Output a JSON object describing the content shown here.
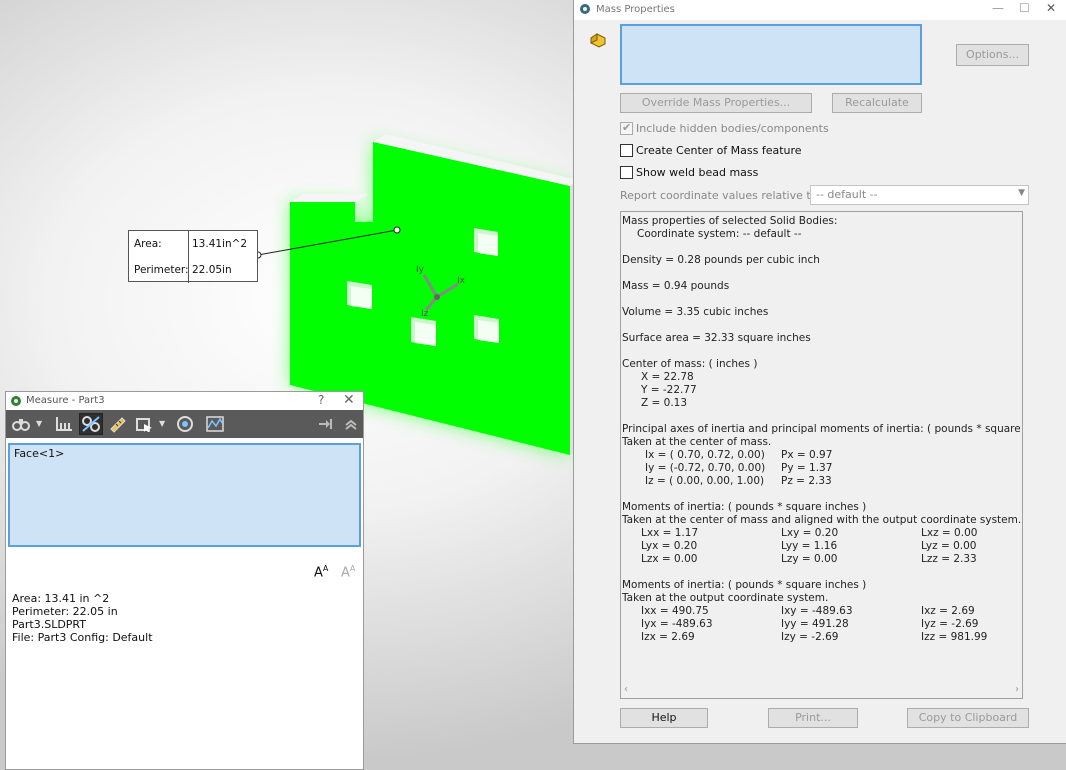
{
  "colors": {
    "face_green": "#00ff00",
    "selection_bg": "#cfe3f7",
    "selection_border": "#5aa0e0",
    "toolbar_dark": "#5a5a5a"
  },
  "viewport": {
    "callout": {
      "area_label": "Area:",
      "area_value": "13.41in^2",
      "perimeter_label": "Perimeter:",
      "perimeter_value": "22.05in"
    },
    "triad": {
      "x_label": "Ix",
      "y_label": "Iy",
      "z_label": "Iz"
    }
  },
  "measure": {
    "title": "Measure - Part3",
    "help_icon": "question-icon",
    "close_icon": "close-icon",
    "toolbar_icons": [
      "units-icon",
      "point-to-point-icon",
      "xyz-measure-icon",
      "ruler-icon",
      "projection-icon",
      "history-icon",
      "sensor-icon",
      "pin-icon",
      "collapse-icon"
    ],
    "selection_item": "Face<1>",
    "results": [
      "Area: 13.41 in ^2",
      "Perimeter: 22.05 in",
      "Part3.SLDPRT",
      "File: Part3 Config: Default"
    ]
  },
  "mass": {
    "title": "Mass Properties",
    "options_label": "Options...",
    "override_label": "Override Mass Properties...",
    "recalculate_label": "Recalculate",
    "include_hidden_label": "Include hidden bodies/components",
    "include_hidden_checked": true,
    "create_com_label": "Create Center of Mass feature",
    "show_weld_label": "Show weld bead mass",
    "report_relative_label": "Report coordinate values relative to:",
    "report_relative_value": "-- default --",
    "help_label": "Help",
    "print_label": "Print...",
    "copy_label": "Copy to Clipboard",
    "report": {
      "heading": "Mass properties of selected Solid Bodies:",
      "coord_system": "Coordinate system: -- default --",
      "density": "Density = 0.28 pounds per cubic inch",
      "mass": "Mass = 0.94 pounds",
      "volume": "Volume = 3.35 cubic inches",
      "surface_area": "Surface area = 32.33 square inches",
      "com_heading": "Center of mass: ( inches )",
      "com_x": "X = 22.78",
      "com_y": "Y = -22.77",
      "com_z": "Z = 0.13",
      "principal_heading": "Principal axes of inertia and principal moments of inertia: ( pounds * square inches )",
      "principal_taken": "Taken at the center of mass.",
      "ix": "Ix = ( 0.70,  0.72,  0.00)",
      "iy": "Iy = (-0.72,  0.70,  0.00)",
      "iz": "Iz = ( 0.00,  0.00,  1.00)",
      "px": "Px = 0.97",
      "py": "Py = 1.37",
      "pz": "Pz = 2.33",
      "moi1_heading": "Moments of inertia: ( pounds * square inches )",
      "moi1_taken": "Taken at the center of mass and aligned with the output coordinate system.",
      "moi1": [
        [
          "Lxx = 1.17",
          "Lxy = 0.20",
          "Lxz = 0.00"
        ],
        [
          "Lyx = 0.20",
          "Lyy = 1.16",
          "Lyz = 0.00"
        ],
        [
          "Lzx = 0.00",
          "Lzy = 0.00",
          "Lzz = 2.33"
        ]
      ],
      "moi2_heading": "Moments of inertia: ( pounds * square inches )",
      "moi2_taken": "Taken at the output coordinate system.",
      "moi2": [
        [
          "Ixx = 490.75",
          "Ixy = -489.63",
          "Ixz = 2.69"
        ],
        [
          "Iyx = -489.63",
          "Iyy = 491.28",
          "Iyz = -2.69"
        ],
        [
          "Izx = 2.69",
          "Izy = -2.69",
          "Izz = 981.99"
        ]
      ]
    }
  }
}
